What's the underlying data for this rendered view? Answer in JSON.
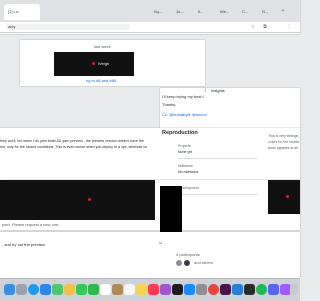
{
  "colors": {
    "link": "#0969da",
    "video_bg": "#111111",
    "red_dot": "#cf222e",
    "dock_bg": "#cfd2d6"
  },
  "browser": {
    "tabs": [
      "[1] Lo...",
      "",
      "",
      "",
      "Sq...",
      "Jo...",
      "li...",
      "We...",
      "C...",
      "N..."
    ],
    "active_tab": "[1] Lo...",
    "url_text": "ably"
  },
  "comments": {
    "last_week": "last week",
    "weight_label": "Weigh",
    "links_line": "ng to  #8  and  #80",
    "keep_trying": "I'll keep trying my best t",
    "thanks": "Thanks,",
    "cc": "Cc: @humabyte @docon",
    "insights_label": "Insights"
  },
  "reproduction": {
    "heading": "Reproduction",
    "body_line1": "they work, but when I do  yarn build && yarn preview , the preview version doesn't have the",
    "body_line2": "ent, only for the closed conditions. This is even worse when you deploy to a vps, whereas no",
    "sidebar": [
      {
        "label": "Projects",
        "value": "None yet"
      },
      {
        "label": "Milestone",
        "value": "No milestone"
      },
      {
        "label": "Development",
        "value": ""
      }
    ],
    "right_line1": "This is very strange.",
    "right_line2": "colors for the locatio",
    "right_line3": "team appears at all."
  },
  "lower": {
    "replied": "pted. Please request a new one.",
    "preview_line": ", and try out the preview.",
    "participants": "4 participants",
    "and_others": "and others"
  },
  "dock": {
    "apps": [
      "finder",
      "launchpad",
      "safari",
      "mail",
      "maps",
      "photos",
      "messages",
      "facetime",
      "calendar",
      "contacts",
      "reminders",
      "notes",
      "music",
      "podcasts",
      "tv",
      "app-store",
      "settings",
      "chrome",
      "slack",
      "vscode",
      "terminal",
      "spotify",
      "discord",
      "figma",
      "trash"
    ]
  }
}
